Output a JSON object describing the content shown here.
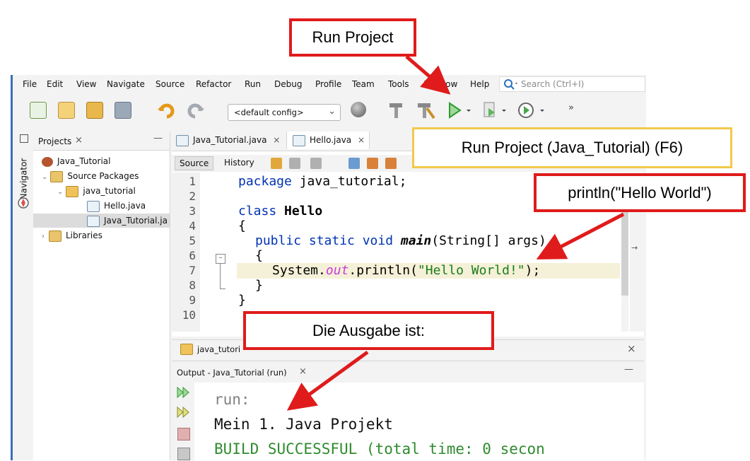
{
  "menu": {
    "items": [
      "File",
      "Edit",
      "View",
      "Navigate",
      "Source",
      "Refactor",
      "Run",
      "Debug",
      "Profile",
      "Team",
      "Tools",
      "Window",
      "Help"
    ],
    "search_placeholder": "Search (Ctrl+I)"
  },
  "toolbar": {
    "config_value": "<default config>"
  },
  "projects": {
    "tab_label": "Projects",
    "tree": [
      {
        "label": "Java_Tutorial"
      },
      {
        "label": "Source Packages"
      },
      {
        "label": "java_tutorial"
      },
      {
        "label": "Hello.java"
      },
      {
        "label": "Java_Tutorial.ja"
      },
      {
        "label": "Libraries"
      }
    ],
    "navigator_label": "Navigator"
  },
  "editor": {
    "tabs": [
      "Java_Tutorial.java",
      "Hello.java"
    ],
    "sub_buttons": [
      "Source",
      "History"
    ],
    "line_numbers": [
      "1",
      "2",
      "3",
      "4",
      "5",
      "6",
      "7",
      "8",
      "9",
      "10"
    ],
    "code": {
      "l1_kw": "package",
      "l1_rest": " java_tutorial;",
      "l3_kw": "class",
      "l3_name": " Hello",
      "l4": "{",
      "l5_kw": "public static void",
      "l5_method": " main",
      "l5_rest": "(String[] args)",
      "l6": "{",
      "l7_pre": "System.",
      "l7_field": "out",
      "l7_mid": ".println(",
      "l7_str": "\"Hello World!\"",
      "l7_end": ");",
      "l8": "}",
      "l9": "}"
    }
  },
  "breadcrumb": {
    "label": "java_tutori"
  },
  "output": {
    "tab_label": "Output - Java_Tutorial (run)",
    "lines": [
      "run:",
      "Mein 1. Java Projekt",
      "BUILD SUCCESSFUL (total time: 0 secon"
    ]
  },
  "annotations": {
    "run_project": "Run Project",
    "tooltip": "Run Project (Java_Tutorial) (F6)",
    "println": "println(\"Hello World\")",
    "ausgabe": "Die Ausgabe ist:"
  },
  "colors": {
    "callout_border": "#e01b1b",
    "tooltip_border": "#f2c94c",
    "keyword": "#0033b3",
    "string": "#1a7d1a",
    "output_green": "#2e8b2e"
  }
}
